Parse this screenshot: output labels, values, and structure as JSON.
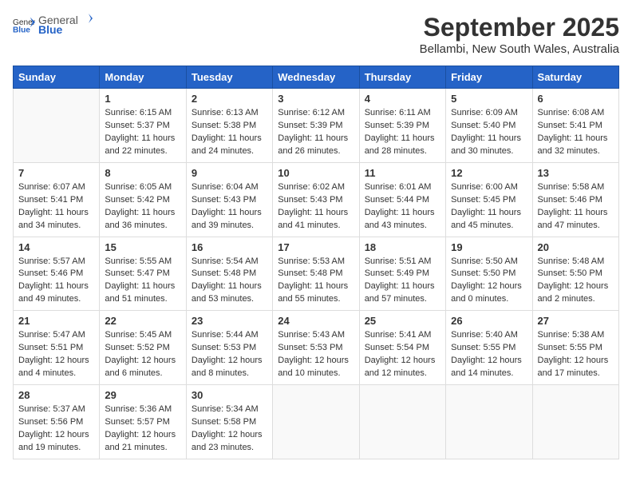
{
  "header": {
    "logo_general": "General",
    "logo_blue": "Blue",
    "month": "September 2025",
    "location": "Bellambi, New South Wales, Australia"
  },
  "weekdays": [
    "Sunday",
    "Monday",
    "Tuesday",
    "Wednesday",
    "Thursday",
    "Friday",
    "Saturday"
  ],
  "weeks": [
    [
      {
        "day": "",
        "info": ""
      },
      {
        "day": "1",
        "info": "Sunrise: 6:15 AM\nSunset: 5:37 PM\nDaylight: 11 hours\nand 22 minutes."
      },
      {
        "day": "2",
        "info": "Sunrise: 6:13 AM\nSunset: 5:38 PM\nDaylight: 11 hours\nand 24 minutes."
      },
      {
        "day": "3",
        "info": "Sunrise: 6:12 AM\nSunset: 5:39 PM\nDaylight: 11 hours\nand 26 minutes."
      },
      {
        "day": "4",
        "info": "Sunrise: 6:11 AM\nSunset: 5:39 PM\nDaylight: 11 hours\nand 28 minutes."
      },
      {
        "day": "5",
        "info": "Sunrise: 6:09 AM\nSunset: 5:40 PM\nDaylight: 11 hours\nand 30 minutes."
      },
      {
        "day": "6",
        "info": "Sunrise: 6:08 AM\nSunset: 5:41 PM\nDaylight: 11 hours\nand 32 minutes."
      }
    ],
    [
      {
        "day": "7",
        "info": "Sunrise: 6:07 AM\nSunset: 5:41 PM\nDaylight: 11 hours\nand 34 minutes."
      },
      {
        "day": "8",
        "info": "Sunrise: 6:05 AM\nSunset: 5:42 PM\nDaylight: 11 hours\nand 36 minutes."
      },
      {
        "day": "9",
        "info": "Sunrise: 6:04 AM\nSunset: 5:43 PM\nDaylight: 11 hours\nand 39 minutes."
      },
      {
        "day": "10",
        "info": "Sunrise: 6:02 AM\nSunset: 5:43 PM\nDaylight: 11 hours\nand 41 minutes."
      },
      {
        "day": "11",
        "info": "Sunrise: 6:01 AM\nSunset: 5:44 PM\nDaylight: 11 hours\nand 43 minutes."
      },
      {
        "day": "12",
        "info": "Sunrise: 6:00 AM\nSunset: 5:45 PM\nDaylight: 11 hours\nand 45 minutes."
      },
      {
        "day": "13",
        "info": "Sunrise: 5:58 AM\nSunset: 5:46 PM\nDaylight: 11 hours\nand 47 minutes."
      }
    ],
    [
      {
        "day": "14",
        "info": "Sunrise: 5:57 AM\nSunset: 5:46 PM\nDaylight: 11 hours\nand 49 minutes."
      },
      {
        "day": "15",
        "info": "Sunrise: 5:55 AM\nSunset: 5:47 PM\nDaylight: 11 hours\nand 51 minutes."
      },
      {
        "day": "16",
        "info": "Sunrise: 5:54 AM\nSunset: 5:48 PM\nDaylight: 11 hours\nand 53 minutes."
      },
      {
        "day": "17",
        "info": "Sunrise: 5:53 AM\nSunset: 5:48 PM\nDaylight: 11 hours\nand 55 minutes."
      },
      {
        "day": "18",
        "info": "Sunrise: 5:51 AM\nSunset: 5:49 PM\nDaylight: 11 hours\nand 57 minutes."
      },
      {
        "day": "19",
        "info": "Sunrise: 5:50 AM\nSunset: 5:50 PM\nDaylight: 12 hours\nand 0 minutes."
      },
      {
        "day": "20",
        "info": "Sunrise: 5:48 AM\nSunset: 5:50 PM\nDaylight: 12 hours\nand 2 minutes."
      }
    ],
    [
      {
        "day": "21",
        "info": "Sunrise: 5:47 AM\nSunset: 5:51 PM\nDaylight: 12 hours\nand 4 minutes."
      },
      {
        "day": "22",
        "info": "Sunrise: 5:45 AM\nSunset: 5:52 PM\nDaylight: 12 hours\nand 6 minutes."
      },
      {
        "day": "23",
        "info": "Sunrise: 5:44 AM\nSunset: 5:53 PM\nDaylight: 12 hours\nand 8 minutes."
      },
      {
        "day": "24",
        "info": "Sunrise: 5:43 AM\nSunset: 5:53 PM\nDaylight: 12 hours\nand 10 minutes."
      },
      {
        "day": "25",
        "info": "Sunrise: 5:41 AM\nSunset: 5:54 PM\nDaylight: 12 hours\nand 12 minutes."
      },
      {
        "day": "26",
        "info": "Sunrise: 5:40 AM\nSunset: 5:55 PM\nDaylight: 12 hours\nand 14 minutes."
      },
      {
        "day": "27",
        "info": "Sunrise: 5:38 AM\nSunset: 5:55 PM\nDaylight: 12 hours\nand 17 minutes."
      }
    ],
    [
      {
        "day": "28",
        "info": "Sunrise: 5:37 AM\nSunset: 5:56 PM\nDaylight: 12 hours\nand 19 minutes."
      },
      {
        "day": "29",
        "info": "Sunrise: 5:36 AM\nSunset: 5:57 PM\nDaylight: 12 hours\nand 21 minutes."
      },
      {
        "day": "30",
        "info": "Sunrise: 5:34 AM\nSunset: 5:58 PM\nDaylight: 12 hours\nand 23 minutes."
      },
      {
        "day": "",
        "info": ""
      },
      {
        "day": "",
        "info": ""
      },
      {
        "day": "",
        "info": ""
      },
      {
        "day": "",
        "info": ""
      }
    ]
  ]
}
